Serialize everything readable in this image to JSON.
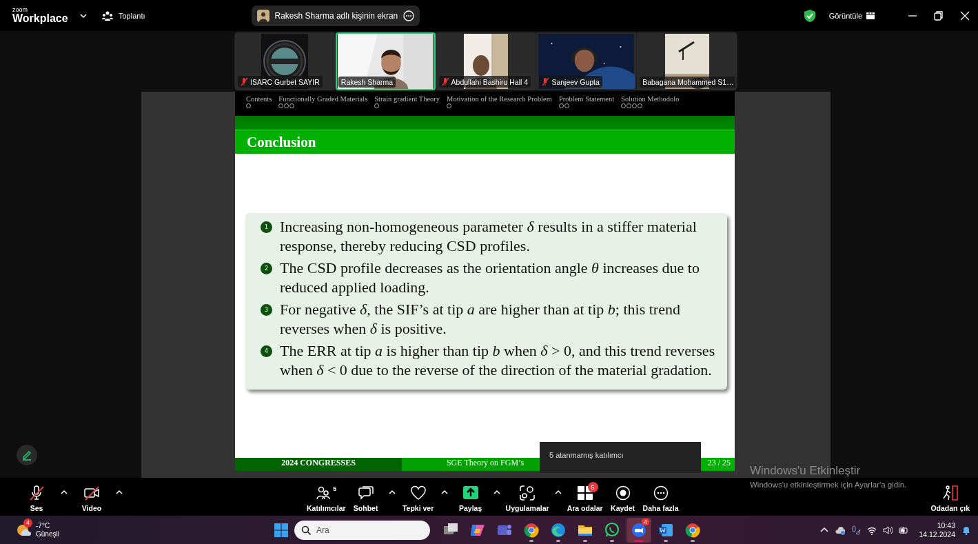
{
  "top_bar": {
    "logo_small": "zoom",
    "logo": "Workplace",
    "meeting_menu": "Toplantı",
    "share_banner": "Rakesh Sharma adlı kişinin ekran",
    "view_button": "Görüntüle"
  },
  "video_tiles": [
    {
      "name": "ISARC Gurbet SAYIR",
      "muted": true,
      "speaking": false,
      "kind": "logo"
    },
    {
      "name": "Rakesh Sharma",
      "muted": false,
      "speaking": true,
      "kind": "person"
    },
    {
      "name": "Abdullahi Bashiru Hall 4",
      "muted": true,
      "speaking": false,
      "kind": "narrow_person"
    },
    {
      "name": "Sanjeev Gupta",
      "muted": true,
      "speaking": false,
      "kind": "space_person"
    },
    {
      "name": "Babagana Mohammed S1…",
      "muted": false,
      "speaking": false,
      "kind": "room"
    }
  ],
  "slide": {
    "nav": [
      {
        "label": "Contents",
        "dots": [
          {
            "current": false
          }
        ]
      },
      {
        "label": "Functionally Graded Materials",
        "dots": [
          {
            "current": false
          },
          {
            "current": false
          },
          {
            "current": false
          }
        ]
      },
      {
        "label": "Strain gradient Theory",
        "dots": [
          {
            "current": false
          }
        ]
      },
      {
        "label": "Motivation of the Research Problem",
        "dots": [
          {
            "current": false
          }
        ]
      },
      {
        "label": "Problem Statement",
        "dots": [
          {
            "current": false
          },
          {
            "current": false
          }
        ]
      },
      {
        "label": "Solution Methodolo",
        "dots": [
          {
            "current": false
          },
          {
            "current": false
          },
          {
            "current": false
          },
          {
            "current": false
          }
        ]
      }
    ],
    "title": "Conclusion",
    "items": [
      {
        "marker": "1",
        "text": "Increasing non-homogeneous parameter *δ* results in a stiffer material response, thereby reducing CSD profiles."
      },
      {
        "marker": "2",
        "text": "The CSD profile decreases as the orientation angle *θ* increases due to reduced applied loading."
      },
      {
        "marker": "3",
        "text": "For negative *δ*, the SIF’s at tip *a* are higher than at tip *b*; this trend reverses when *δ* is positive."
      },
      {
        "marker": "4",
        "text": "The ERR at tip *a* is higher than tip *b* when *δ* > 0, and this trend reverses when *δ* < 0 due to the reverse of the direction of the material gradation."
      }
    ],
    "footer": [
      "2024 CONGRESSES",
      "SGE Theory on FGM’s",
      "23 / 25"
    ]
  },
  "tooltip": "5 atanmamış katılımcı",
  "activation_notice": {
    "title": "Windows'u Etkinleştir",
    "text": "Windows'u etkinleştirmek için Ayarlar'a gidin."
  },
  "toolbar": [
    {
      "kind": "audio",
      "label": "Ses",
      "off": true,
      "caret": true
    },
    {
      "kind": "video",
      "label": "Video",
      "off": true,
      "caret": true
    },
    {
      "kind": "participants",
      "label": "Katılımcılar",
      "count": "5",
      "caret": false
    },
    {
      "kind": "chat",
      "label": "Sohbet",
      "caret": true
    },
    {
      "kind": "reactions",
      "label": "Tepki ver",
      "caret": true
    },
    {
      "kind": "share",
      "label": "Paylaş",
      "caret": true
    },
    {
      "kind": "apps",
      "label": "Uygulamalar",
      "caret": true
    },
    {
      "kind": "rooms",
      "label": "Ara odalar",
      "badge": "5",
      "caret": false
    },
    {
      "kind": "record",
      "label": "Kaydet",
      "caret": false
    },
    {
      "kind": "more",
      "label": "Daha fazla",
      "caret": false
    }
  ],
  "leave": {
    "label": "Odadan çık"
  },
  "taskbar": {
    "weather": {
      "badge": "4",
      "temperature": "-7°C",
      "condition": "Güneşli"
    },
    "search_placeholder": "Ara",
    "apps": [
      {
        "kind": "taskview",
        "running": false,
        "active": false
      },
      {
        "kind": "copilot",
        "running": false,
        "active": false
      },
      {
        "kind": "teams",
        "running": false,
        "active": false
      },
      {
        "kind": "chrome",
        "running": true,
        "active": false
      },
      {
        "kind": "edge",
        "running": true,
        "active": false
      },
      {
        "kind": "files",
        "running": true,
        "active": false
      },
      {
        "kind": "whatsapp",
        "running": true,
        "active": false
      },
      {
        "kind": "zoom",
        "running": true,
        "active": true,
        "badge": "4"
      },
      {
        "kind": "word",
        "running": true,
        "active": false
      },
      {
        "kind": "chrome",
        "running": true,
        "active": false
      }
    ],
    "time": "10:43",
    "date": "14.12.2024"
  }
}
